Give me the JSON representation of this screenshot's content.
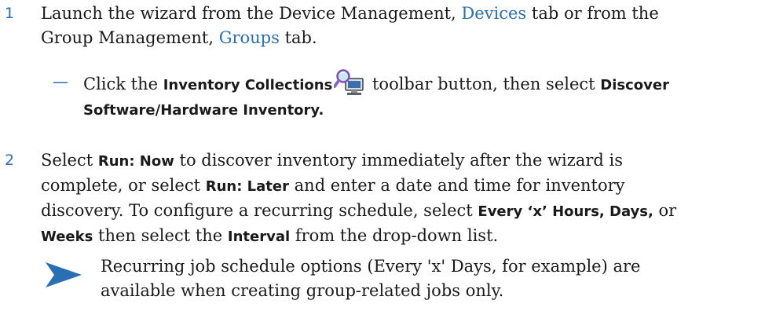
{
  "steps": [
    {
      "number": "1",
      "lines": [
        {
          "t1": "Launch the wizard from the Device Management, ",
          "link1": "Devices",
          "t2": " tab or from the"
        },
        {
          "t1": "Group Management, ",
          "link1": "Groups",
          "t2": " tab."
        }
      ],
      "substep": {
        "dash": "—",
        "t1": "Click the ",
        "b1": "Inventory Collections",
        "icon": "inventory-collections-icon",
        "t2": " toolbar button, then select ",
        "b2": "Discover",
        "b3": "Software/Hardware Inventory."
      }
    },
    {
      "number": "2",
      "l1_t1": "Select ",
      "l1_b1": "Run: Now",
      "l1_t2": " to discover inventory immediately after the wizard is",
      "l2_t1": "complete, or select ",
      "l2_b1": "Run: Later",
      "l2_t2": " and enter a date and time for inventory",
      "l3_t1": "discovery. To configure a recurring schedule, select ",
      "l3_b1": "Every ‘x’ Hours, Days,",
      "l3_t2": " or",
      "l4_b1": "Weeks",
      "l4_t1": " then select the ",
      "l4_b2": "Interval",
      "l4_t2": " from the drop-down list."
    }
  ],
  "note": {
    "icon": "note-arrow-icon",
    "line1": "Recurring job schedule options (Every 'x' Days, for example) are",
    "line2": "available when creating group-related jobs only."
  },
  "colors": {
    "accent": "#2a6fb3",
    "text": "#1a1a1a"
  }
}
